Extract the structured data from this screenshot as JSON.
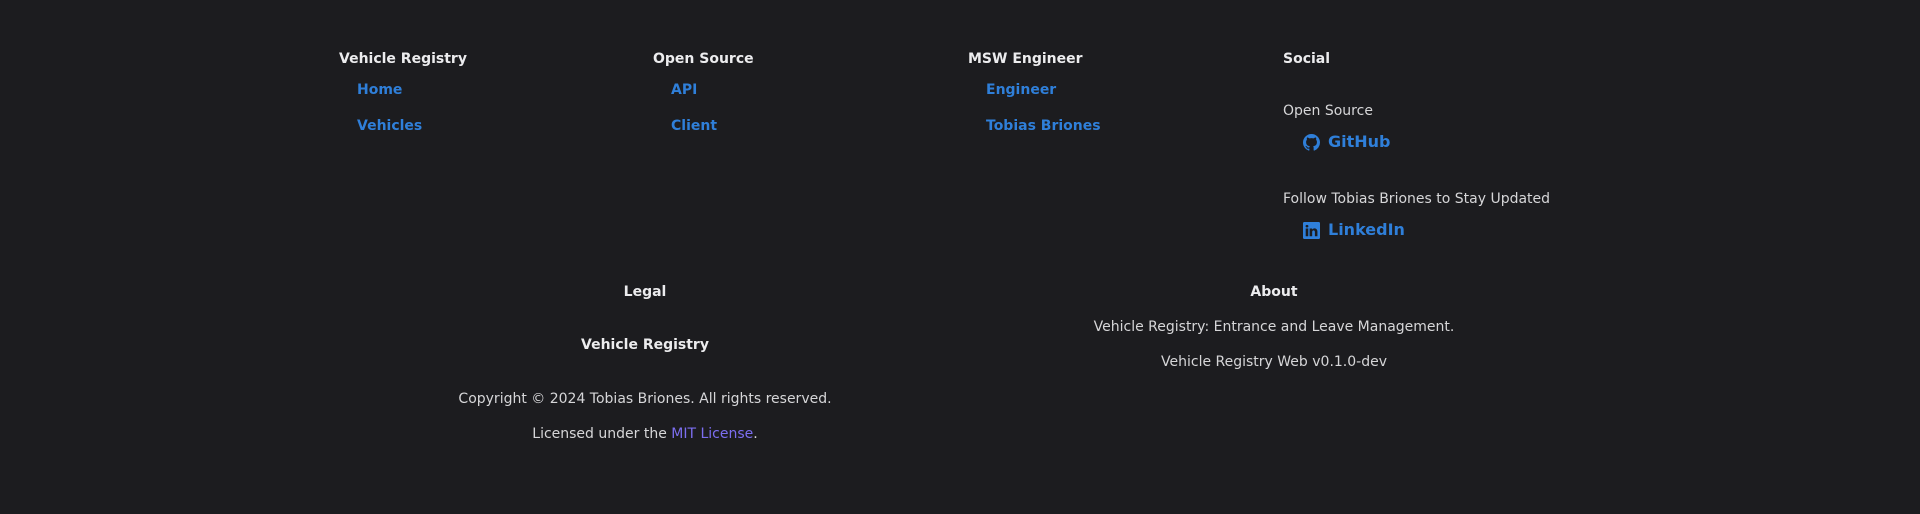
{
  "columns": [
    {
      "title": "Vehicle Registry",
      "links": [
        "Home",
        "Vehicles"
      ]
    },
    {
      "title": "Open Source",
      "links": [
        "API",
        "Client"
      ]
    },
    {
      "title": "MSW Engineer",
      "links": [
        "Engineer",
        "Tobias Briones"
      ]
    }
  ],
  "social": {
    "title": "Social",
    "groups": [
      {
        "label": "Open Source",
        "link": "GitHub",
        "icon": "github-icon"
      },
      {
        "label": "Follow Tobias Briones to Stay Updated",
        "link": "LinkedIn",
        "icon": "linkedin-icon"
      }
    ]
  },
  "legal": {
    "title": "Legal",
    "subtitle": "Vehicle Registry",
    "copyright": "Copyright © 2024 Tobias Briones. All rights reserved.",
    "license_prefix": "Licensed under the ",
    "license_link": "MIT License",
    "license_suffix": "."
  },
  "about": {
    "title": "About",
    "description": "Vehicle Registry: Entrance and Leave Management.",
    "version": "Vehicle Registry Web v0.1.0-dev"
  },
  "colors": {
    "background": "#1c1c1f",
    "link": "#2f7fd9",
    "license_link": "#7c6ef0",
    "text": "#d6d6d8"
  }
}
